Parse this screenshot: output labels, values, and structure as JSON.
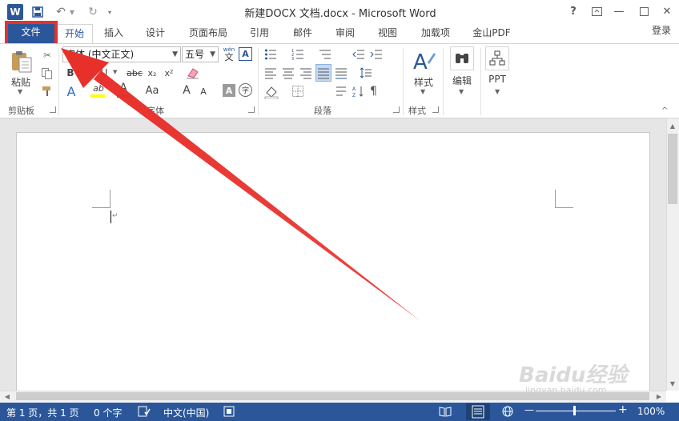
{
  "app": {
    "title": "新建DOCX 文档.docx - Microsoft Word"
  },
  "title_bar": {
    "help": "?",
    "minimize": "—",
    "close": "✕"
  },
  "tabs": [
    {
      "label": "文件"
    },
    {
      "label": "开始"
    },
    {
      "label": "插入"
    },
    {
      "label": "设计"
    },
    {
      "label": "页面布局"
    },
    {
      "label": "引用"
    },
    {
      "label": "邮件"
    },
    {
      "label": "审阅"
    },
    {
      "label": "视图"
    },
    {
      "label": "加载项"
    },
    {
      "label": "金山PDF"
    }
  ],
  "account": {
    "login": "登录"
  },
  "clipboard": {
    "paste_label": "粘贴",
    "group_label": "剪贴板"
  },
  "font": {
    "font_name": "宋体 (中文正文)",
    "font_size": "五号",
    "wen": "wén",
    "wen_char": "文",
    "box_a": "A",
    "bold": "B",
    "italic": "I",
    "underline": "U",
    "strike": "abc",
    "subscript": "x₂",
    "superscript": "x²",
    "text_effects": "A",
    "highlight": "ab",
    "font_color": "A",
    "change_case": "Aa",
    "grow": "A",
    "shrink": "A",
    "char_shading": "A",
    "enclose": "字",
    "group_label": "字体"
  },
  "paragraph": {
    "group_label": "段落"
  },
  "styles": {
    "label": "样式",
    "group_label": "样式"
  },
  "editing": {
    "label": "编辑"
  },
  "ppt": {
    "label": "PPT"
  },
  "status": {
    "page": "第 1 页，共 1 页",
    "words": "0 个字",
    "language": "中文(中国)",
    "zoom_minus": "—",
    "zoom_plus": "+",
    "zoom": "100%"
  },
  "watermark": {
    "brand": "Baidu经验",
    "url": "jingyan.baidu.com"
  },
  "colors": {
    "accent": "#2b579a",
    "highlight_box": "#e8302b",
    "arrow": "#e8302b"
  }
}
